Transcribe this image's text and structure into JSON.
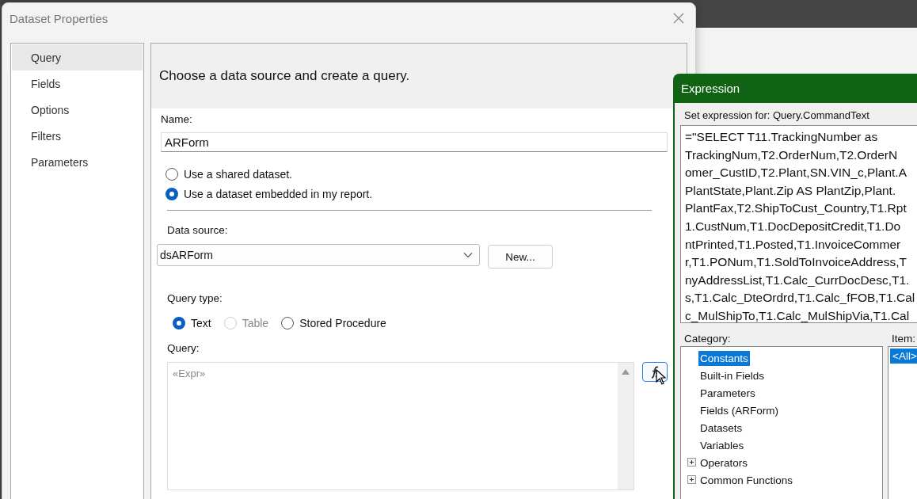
{
  "dialog": {
    "title": "Dataset Properties",
    "sidebar": [
      {
        "label": "Query",
        "selected": true
      },
      {
        "label": "Fields",
        "selected": false
      },
      {
        "label": "Options",
        "selected": false
      },
      {
        "label": "Filters",
        "selected": false
      },
      {
        "label": "Parameters",
        "selected": false
      }
    ],
    "heading": "Choose a data source and create a query.",
    "name_label": "Name:",
    "name_value": "ARForm",
    "dataset_options": [
      {
        "label": "Use a shared dataset.",
        "selected": false
      },
      {
        "label": "Use a dataset embedded in my report.",
        "selected": true
      }
    ],
    "data_source_label": "Data source:",
    "data_source_value": "dsARForm",
    "new_button": "New...",
    "query_type_label": "Query type:",
    "query_types": [
      {
        "label": "Text",
        "selected": true,
        "disabled": false
      },
      {
        "label": "Table",
        "selected": false,
        "disabled": true
      },
      {
        "label": "Stored Procedure",
        "selected": false,
        "disabled": false
      }
    ],
    "query_label": "Query:",
    "query_placeholder": "«Expr»"
  },
  "expression": {
    "title": "Expression",
    "set_label": "Set expression for: Query.CommandText",
    "lines": [
      "=\"SELECT T11.TrackingNumber as",
      "TrackingNum,T2.OrderNum,T2.OrderN",
      "omer_CustID,T2.Plant,SN.VIN_c,Plant.A",
      "PlantState,Plant.Zip AS PlantZip,Plant.",
      "PlantFax,T2.ShipToCust_Country,T1.Rpt",
      "1.CustNum,T1.DocDepositCredit,T1.Do",
      "ntPrinted,T1.Posted,T1.InvoiceCommer",
      "r,T1.PONum,T1.SoldToInvoiceAddress,T",
      "nyAddressList,T1.Calc_CurrDocDesc,T1.",
      "s,T1.Calc_DteOrdrd,T1.Calc_fFOB,T1.Cal",
      "c_MulShipTo,T1.Calc_MulShipVia,T1.Cal"
    ],
    "category_label": "Category:",
    "categories": [
      {
        "label": "Constants",
        "kind": "leaf",
        "selected": true
      },
      {
        "label": "Built-in Fields",
        "kind": "leaf",
        "selected": false
      },
      {
        "label": "Parameters",
        "kind": "leaf",
        "selected": false
      },
      {
        "label": "Fields (ARForm)",
        "kind": "leaf",
        "selected": false
      },
      {
        "label": "Datasets",
        "kind": "leaf",
        "selected": false
      },
      {
        "label": "Variables",
        "kind": "leaf",
        "selected": false
      },
      {
        "label": "Operators",
        "kind": "group",
        "expanded": false,
        "selected": false
      },
      {
        "label": "Common Functions",
        "kind": "group",
        "expanded": false,
        "selected": false
      }
    ],
    "item_label": "Item:",
    "items": [
      {
        "label": "<All>",
        "selected": true
      }
    ]
  }
}
